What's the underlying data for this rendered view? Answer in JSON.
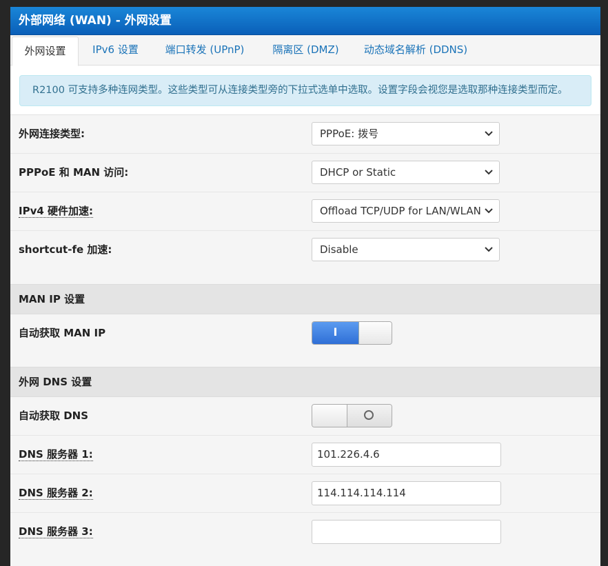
{
  "panel": {
    "title": "外部网络 (WAN) - 外网设置"
  },
  "tabs": [
    {
      "label": "外网设置"
    },
    {
      "label": "IPv6 设置"
    },
    {
      "label": "端口转发 (UPnP)"
    },
    {
      "label": "隔离区 (DMZ)"
    },
    {
      "label": "动态域名解析 (DDNS)"
    }
  ],
  "info": {
    "text": "R2100 可支持多种连网类型。这些类型可从连接类型旁的下拉式选单中选取。设置字段会视您是选取那种连接类型而定。"
  },
  "form": {
    "wan_type": {
      "label": "外网连接类型:",
      "value": "PPPoE: 拨号"
    },
    "pppoe_man": {
      "label": "PPPoE 和 MAN 访问:",
      "value": "DHCP or Static"
    },
    "ipv4_hw": {
      "label": "IPv4 硬件加速:",
      "value": "Offload TCP/UDP for LAN/WLAN"
    },
    "shortcut_fe": {
      "label": "shortcut-fe 加速:",
      "value": "Disable"
    }
  },
  "man_ip": {
    "section_title": "MAN IP 设置",
    "auto_label": "自动获取 MAN IP",
    "toggle_on_text": "I",
    "enabled": true
  },
  "dns": {
    "section_title": "外网 DNS 设置",
    "auto_label": "自动获取 DNS",
    "enabled": false,
    "server1_label": "DNS 服务器 1:",
    "server1_value": "101.226.4.6",
    "server2_label": "DNS 服务器 2:",
    "server2_value": "114.114.114.114",
    "server3_label": "DNS 服务器 3:",
    "server3_value": ""
  },
  "icons": {
    "select_arrow": "chevron-down-icon",
    "toggle_off": "circle-icon"
  },
  "colors": {
    "header_blue": "#0a5fb8",
    "link_blue": "#1a73b8",
    "toggle_on": "#2f6fd6",
    "info_bg": "#d9edf7"
  }
}
